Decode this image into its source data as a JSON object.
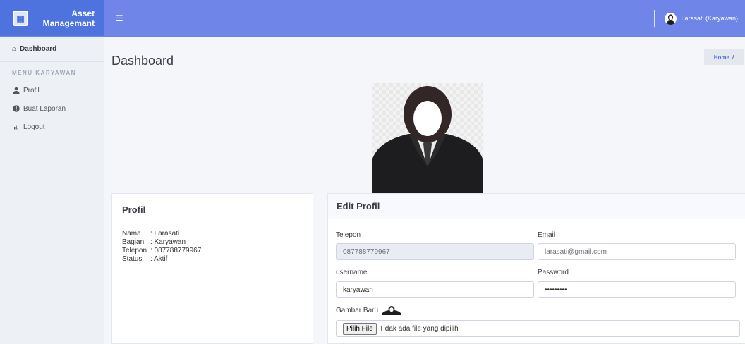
{
  "brand": {
    "line1": "Asset",
    "line2": "Managemant"
  },
  "topbar": {
    "user_name": "Larasati (Karyawan)"
  },
  "sidebar": {
    "dashboard": "Dashboard",
    "heading": "MENU KARYAWAN",
    "items": [
      {
        "label": "Profil",
        "icon": "user-icon"
      },
      {
        "label": "Buat Laporan",
        "icon": "info-circle-icon"
      },
      {
        "label": "Logout",
        "icon": "chart-icon"
      }
    ]
  },
  "page": {
    "title": "Dashboard",
    "breadcrumb_home": "Home",
    "breadcrumb_sep": "/"
  },
  "profil": {
    "title": "Profil",
    "rows": [
      {
        "key": "Nama",
        "value": ": Larasati"
      },
      {
        "key": "Bagian",
        "value": ": Karyawan"
      },
      {
        "key": "Telepon",
        "value": ": 087788779967"
      },
      {
        "key": "Status",
        "value": ": Aktif"
      }
    ]
  },
  "edit": {
    "title": "Edit Profil",
    "telepon_label": "Telepon",
    "telepon_value": "087788779967",
    "email_label": "Email",
    "email_value": "larasati@gmail.com",
    "username_label": "username",
    "username_value": "karyawan",
    "password_label": "Password",
    "password_value": "•••••••••",
    "gambar_label": "Gambar Baru",
    "file_button": "Pilih File",
    "file_status": "Tidak ada file yang dipilih"
  },
  "colors": {
    "brand": "#4e73df",
    "topbar": "#6f85e8",
    "sidebar": "#edf0f5"
  }
}
